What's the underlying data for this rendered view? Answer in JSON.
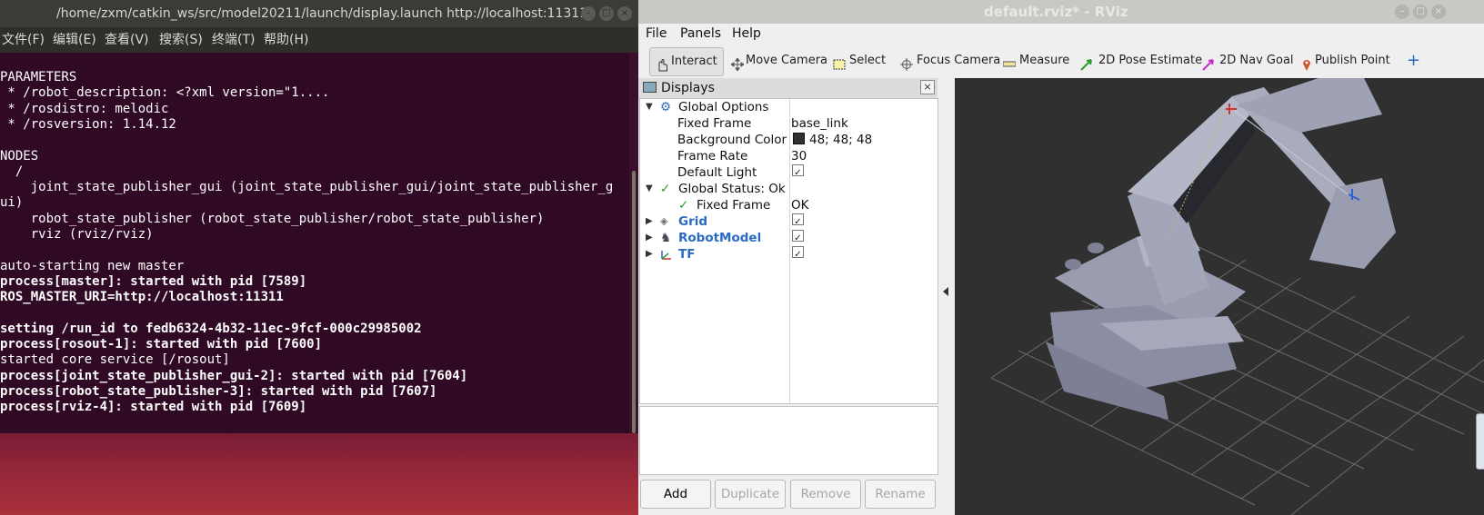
{
  "terminal": {
    "title": "/home/zxm/catkin_ws/src/model20211/launch/display.launch http://localhost:11311",
    "menu": [
      "文件(F)",
      "编辑(E)",
      "查看(V)",
      "搜索(S)",
      "终端(T)",
      "帮助(H)"
    ],
    "lines": [
      {
        "text": "PARAMETERS",
        "bold": false
      },
      {
        "text": " * /robot_description: <?xml version=\"1....",
        "bold": false
      },
      {
        "text": " * /rosdistro: melodic",
        "bold": false
      },
      {
        "text": " * /rosversion: 1.14.12",
        "bold": false
      },
      {
        "text": "",
        "bold": false
      },
      {
        "text": "NODES",
        "bold": false
      },
      {
        "text": "  /",
        "bold": false
      },
      {
        "text": "    joint_state_publisher_gui (joint_state_publisher_gui/joint_state_publisher_g",
        "bold": false
      },
      {
        "text": "ui)",
        "bold": false
      },
      {
        "text": "    robot_state_publisher (robot_state_publisher/robot_state_publisher)",
        "bold": false
      },
      {
        "text": "    rviz (rviz/rviz)",
        "bold": false
      },
      {
        "text": "",
        "bold": false
      },
      {
        "text": "auto-starting new master",
        "bold": false
      },
      {
        "text": "process[master]: started with pid [7589]",
        "bold": true
      },
      {
        "text": "ROS_MASTER_URI=http://localhost:11311",
        "bold": true
      },
      {
        "text": "",
        "bold": false
      },
      {
        "text": "setting /run_id to fedb6324-4b32-11ec-9fcf-000c29985002",
        "bold": true
      },
      {
        "text": "process[rosout-1]: started with pid [7600]",
        "bold": true
      },
      {
        "text": "started core service [/rosout]",
        "bold": false
      },
      {
        "text": "process[joint_state_publisher_gui-2]: started with pid [7604]",
        "bold": true
      },
      {
        "text": "process[robot_state_publisher-3]: started with pid [7607]",
        "bold": true
      },
      {
        "text": "process[rviz-4]: started with pid [7609]",
        "bold": true
      }
    ]
  },
  "rviz": {
    "title": "default.rviz* - RViz",
    "menu": [
      "File",
      "Panels",
      "Help"
    ],
    "tools": [
      "Interact",
      "Move Camera",
      "Select",
      "Focus Camera",
      "Measure",
      "2D Pose Estimate",
      "2D Nav Goal",
      "Publish Point"
    ],
    "displays_title": "Displays",
    "global_options": "Global Options",
    "fixed_frame_label": "Fixed Frame",
    "fixed_frame_value": "base_link",
    "bg_color_label": "Background Color",
    "bg_color_value": "48; 48; 48",
    "frame_rate_label": "Frame Rate",
    "frame_rate_value": "30",
    "default_light_label": "Default Light",
    "global_status": "Global Status: Ok",
    "status_fixed_frame": "Fixed Frame",
    "status_fixed_frame_value": "OK",
    "displays": [
      "Grid",
      "RobotModel",
      "TF"
    ],
    "buttons": [
      "Add",
      "Duplicate",
      "Remove",
      "Rename"
    ],
    "colors": {
      "bg": "#303030",
      "check": "#2a9a2a",
      "link": "#2a6ac2"
    }
  }
}
